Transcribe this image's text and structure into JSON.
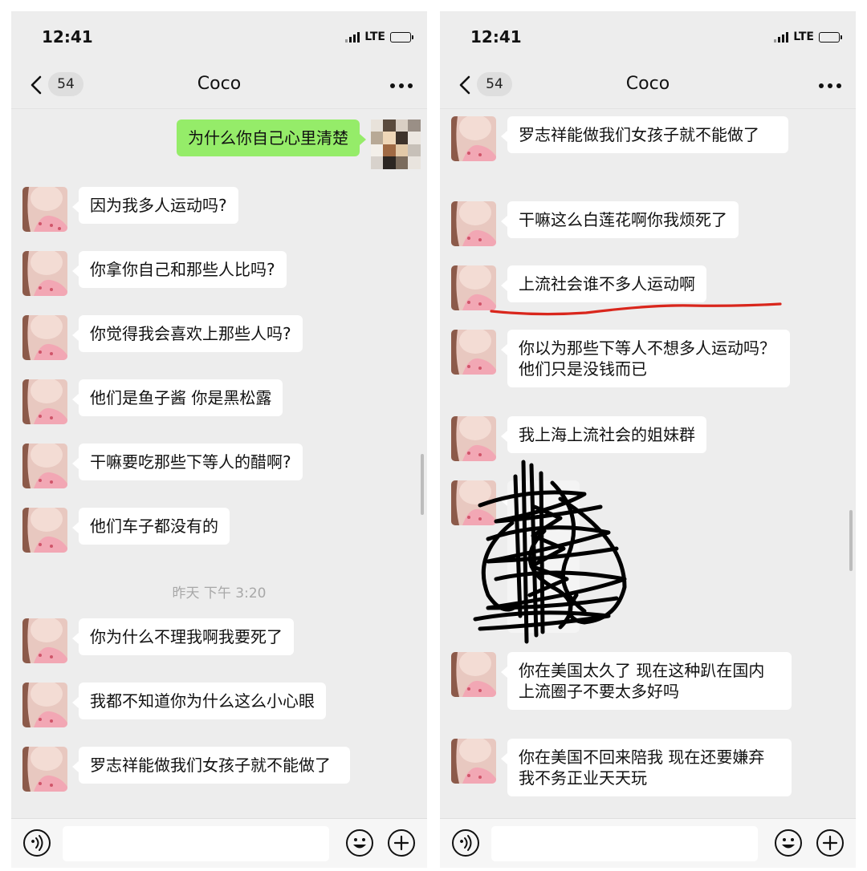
{
  "status": {
    "time": "12:41",
    "network": "LTE"
  },
  "nav": {
    "unread_count": "54",
    "title": "Coco"
  },
  "left": {
    "outgoing": "为什么你自己心里清楚",
    "messages": [
      "因为我多人运动吗?",
      "你拿你自己和那些人比吗?",
      "你觉得我会喜欢上那些人吗?",
      "他们是鱼子酱 你是黑松露",
      "干嘛要吃那些下等人的醋啊?",
      "他们车子都没有的"
    ],
    "time_separator": "昨天 下午 3:20",
    "messages_after": [
      "你为什么不理我啊我要死了",
      "我都不知道你为什么这么小心眼",
      "罗志祥能做我们女孩子就不能做了"
    ]
  },
  "right": {
    "messages": [
      "罗志祥能做我们女孩子就不能做了",
      "干嘛这么白莲花啊你我烦死了",
      "上流社会谁不多人运动啊",
      "你以为那些下等人不想多人运动吗？他们只是没钱而已",
      "我上海上流社会的姐妹群"
    ],
    "messages_after": [
      "你在美国太久了 现在这种趴在国内上流圈子不要太多好吗",
      "你在美国不回来陪我 现在还要嫌弃我不务正业天天玩"
    ]
  },
  "colors": {
    "chat_bg": "#ededed",
    "incoming_bubble": "#ffffff",
    "outgoing_bubble": "#95ec69",
    "annotation_red": "#d9261c",
    "scribble_black": "#000000"
  },
  "icons": [
    "back-chevron-icon",
    "more-dots-icon",
    "voice-icon",
    "emoji-icon",
    "plus-icon",
    "signal-icon",
    "battery-icon"
  ]
}
